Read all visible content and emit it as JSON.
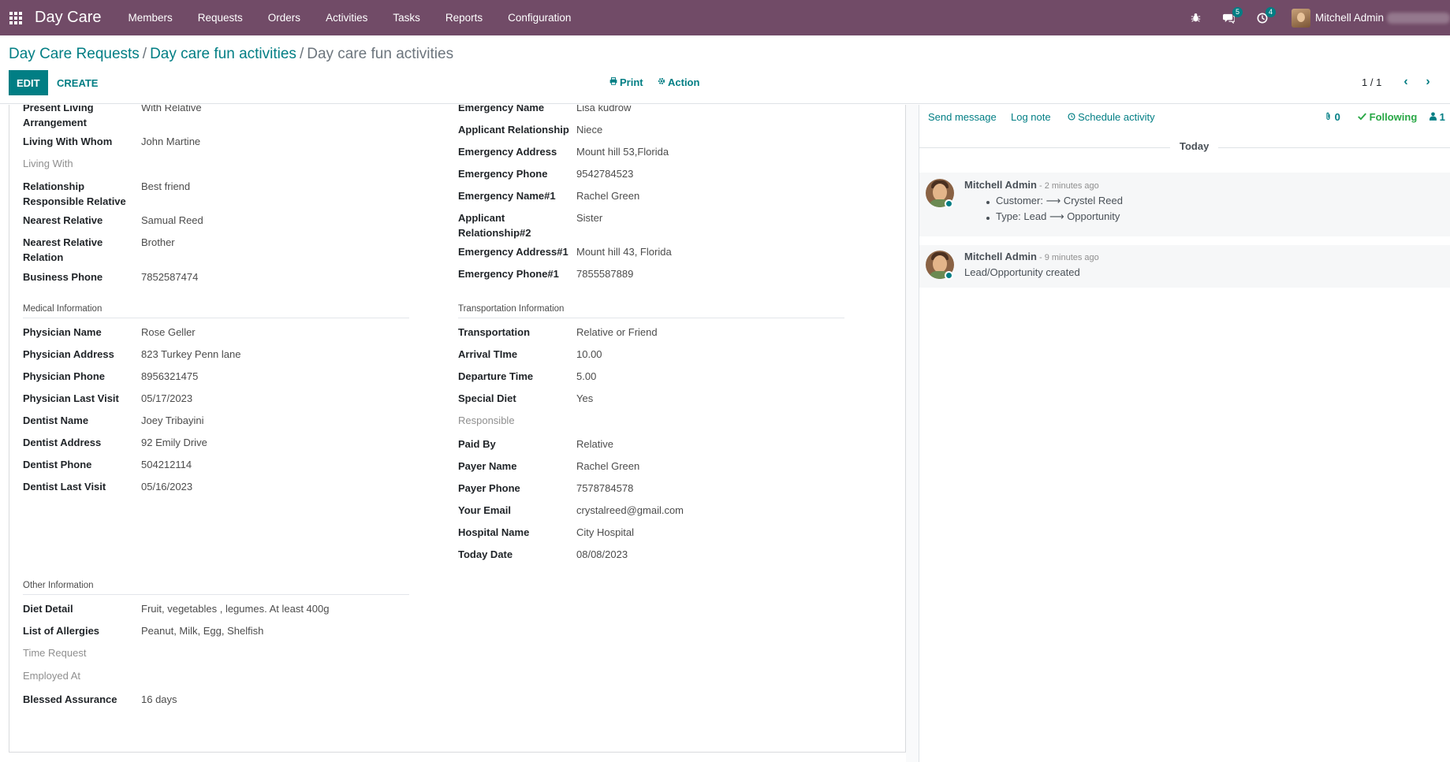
{
  "navbar": {
    "brand": "Day Care",
    "menu": [
      "Members",
      "Requests",
      "Orders",
      "Activities",
      "Tasks",
      "Reports",
      "Configuration"
    ],
    "messages_badge": "5",
    "activities_badge": "4",
    "user_name": "Mitchell Admin"
  },
  "breadcrumb": {
    "items": [
      "Day Care Requests",
      "Day care fun activities"
    ],
    "current": "Day care fun activities"
  },
  "control_panel": {
    "edit_label": "EDIT",
    "create_label": "CREATE",
    "print_label": "Print",
    "action_label": "Action",
    "pager": "1 / 1"
  },
  "form": {
    "left_top": [
      {
        "label": "Present Living Arrangement",
        "value": "With Relative"
      },
      {
        "label": "Living With Whom",
        "value": "John Martine"
      },
      {
        "label": "Living With",
        "value": ""
      },
      {
        "label": "Relationship Responsible Relative",
        "value": "Best friend"
      },
      {
        "label": "Nearest Relative",
        "value": "Samual Reed"
      },
      {
        "label": "Nearest Relative Relation",
        "value": "Brother"
      },
      {
        "label": "Business Phone",
        "value": "7852587474"
      }
    ],
    "right_top": [
      {
        "label": "Emergency Name",
        "value": "Lisa kudrow"
      },
      {
        "label": "Applicant Relationship",
        "value": "Niece"
      },
      {
        "label": "Emergency Address",
        "value": "Mount hill 53,Florida"
      },
      {
        "label": "Emergency Phone",
        "value": "9542784523"
      },
      {
        "label": "Emergency Name#1",
        "value": "Rachel Green"
      },
      {
        "label": "Applicant Relationship#2",
        "value": "Sister"
      },
      {
        "label": "Emergency Address#1",
        "value": "Mount hill 43, Florida"
      },
      {
        "label": "Emergency Phone#1",
        "value": "7855587889"
      }
    ],
    "medical": {
      "title": "Medical Information",
      "fields": [
        {
          "label": "Physician Name",
          "value": "Rose Geller"
        },
        {
          "label": "Physician Address",
          "value": "823 Turkey Penn lane"
        },
        {
          "label": "Physician Phone",
          "value": "8956321475"
        },
        {
          "label": "Physician Last Visit",
          "value": "05/17/2023"
        },
        {
          "label": "Dentist Name",
          "value": "Joey Tribayini"
        },
        {
          "label": "Dentist Address",
          "value": "92 Emily Drive"
        },
        {
          "label": "Dentist Phone",
          "value": "504212114"
        },
        {
          "label": "Dentist Last Visit",
          "value": "05/16/2023"
        }
      ]
    },
    "transportation": {
      "title": "Transportation Information",
      "fields": [
        {
          "label": "Transportation",
          "value": "Relative or Friend"
        },
        {
          "label": "Arrival TIme",
          "value": "10.00"
        },
        {
          "label": "Departure Time",
          "value": "5.00"
        },
        {
          "label": "Special Diet",
          "value": "Yes"
        },
        {
          "label": "Responsible",
          "value": ""
        },
        {
          "label": "Paid By",
          "value": "Relative"
        },
        {
          "label": "Payer Name",
          "value": "Rachel Green"
        },
        {
          "label": "Payer Phone",
          "value": "7578784578"
        },
        {
          "label": "Your Email",
          "value": "crystalreed@gmail.com"
        },
        {
          "label": "Hospital Name",
          "value": "City Hospital"
        },
        {
          "label": "Today Date",
          "value": "08/08/2023"
        }
      ]
    },
    "other": {
      "title": "Other Information",
      "fields": [
        {
          "label": "Diet Detail",
          "value": "Fruit, vegetables , legumes. At least 400g"
        },
        {
          "label": "List of Allergies",
          "value": "Peanut, Milk, Egg, Shelfish"
        },
        {
          "label": "Time Request",
          "value": ""
        },
        {
          "label": "Employed At",
          "value": ""
        },
        {
          "label": "Blessed Assurance",
          "value": "16 days"
        }
      ]
    }
  },
  "chatter": {
    "send_message": "Send message",
    "log_note": "Log note",
    "schedule_activity": "Schedule activity",
    "attachments": "0",
    "following": "Following",
    "followers": "1",
    "date_separator": "Today",
    "messages": [
      {
        "author": "Mitchell Admin",
        "time": "- 2 minutes ago",
        "lines": [
          "Customer: ⟶ Crystel Reed",
          "Type: Lead ⟶ Opportunity"
        ]
      },
      {
        "author": "Mitchell Admin",
        "time": "- 9 minutes ago",
        "lines": [
          "Lead/Opportunity created"
        ]
      }
    ]
  },
  "colors": {
    "navbar": "#714b67",
    "accent": "#017e84",
    "following": "#28a745"
  }
}
